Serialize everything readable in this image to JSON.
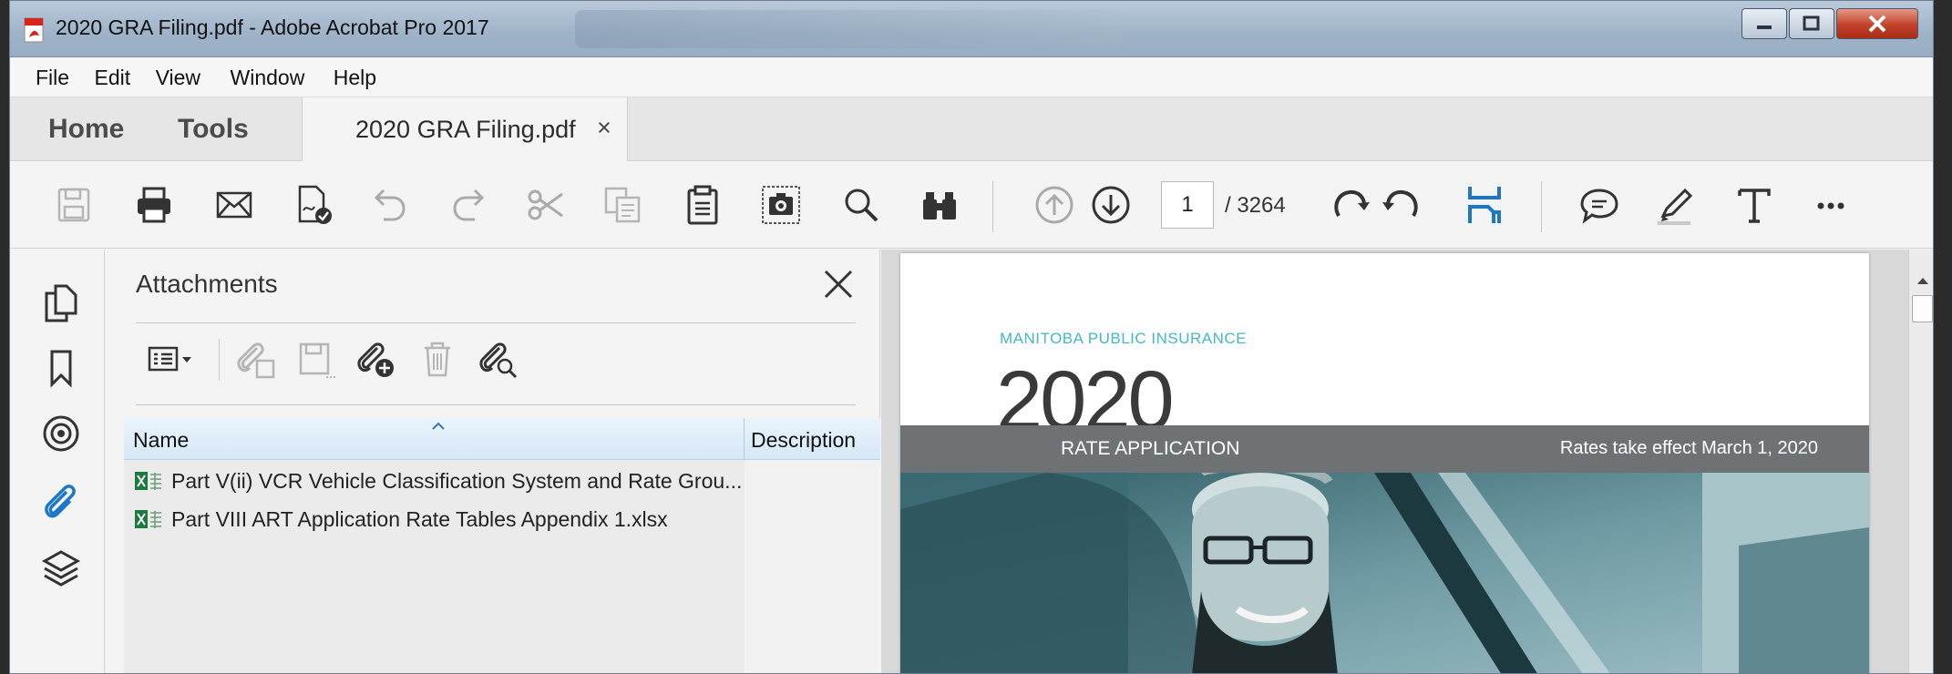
{
  "window": {
    "title": "2020 GRA Filing.pdf - Adobe Acrobat Pro 2017",
    "icon": "pdf-icon",
    "controls": [
      "minimize-icon",
      "maximize-icon",
      "close-icon"
    ]
  },
  "menu": [
    "File",
    "Edit",
    "View",
    "Window",
    "Help"
  ],
  "tabs": {
    "home": "Home",
    "tools": "Tools",
    "document": "2020 GRA Filing.pdf",
    "close": "×"
  },
  "toolbar": {
    "icons": [
      "save-icon",
      "print-icon",
      "email-icon",
      "sign-certify-icon",
      "undo-icon",
      "redo-icon",
      "cut-icon",
      "copy-icon",
      "paste-icon",
      "snapshot-icon",
      "search-icon",
      "find-binoculars-icon",
      "page-up-icon",
      "page-down-icon",
      "rotate-clockwise-icon",
      "rotate-counterclockwise-icon",
      "read-mode-icon",
      "comment-icon",
      "highlight-pen-icon",
      "add-text-icon",
      "more-icon"
    ],
    "page_current": "1",
    "page_total": "/ 3264"
  },
  "leftrail": [
    "page-thumbnails-icon",
    "bookmarks-icon",
    "signatures-icon",
    "attachments-icon",
    "layers-icon"
  ],
  "attachments": {
    "title": "Attachments",
    "tools": [
      "options-menu-icon",
      "open-attachment-icon",
      "save-attachment-icon",
      "add-attachment-icon",
      "delete-attachment-icon",
      "search-attachments-icon"
    ],
    "columns": {
      "name": "Name",
      "description": "Description"
    },
    "rows": [
      {
        "name": "Part V(ii) VCR Vehicle Classification System and Rate Grou...",
        "description": ""
      },
      {
        "name": "Part VIII ART Application Rate Tables Appendix 1.xlsx",
        "description": ""
      }
    ]
  },
  "document": {
    "org": "MANITOBA PUBLIC INSURANCE",
    "year": "2020",
    "band_left": "RATE APPLICATION",
    "band_right": "Rates take effect March 1, 2020"
  },
  "colors": {
    "accent_blue": "#1c77c8",
    "mpi_teal": "#45b8c8",
    "band_gray": "#6f7275"
  }
}
